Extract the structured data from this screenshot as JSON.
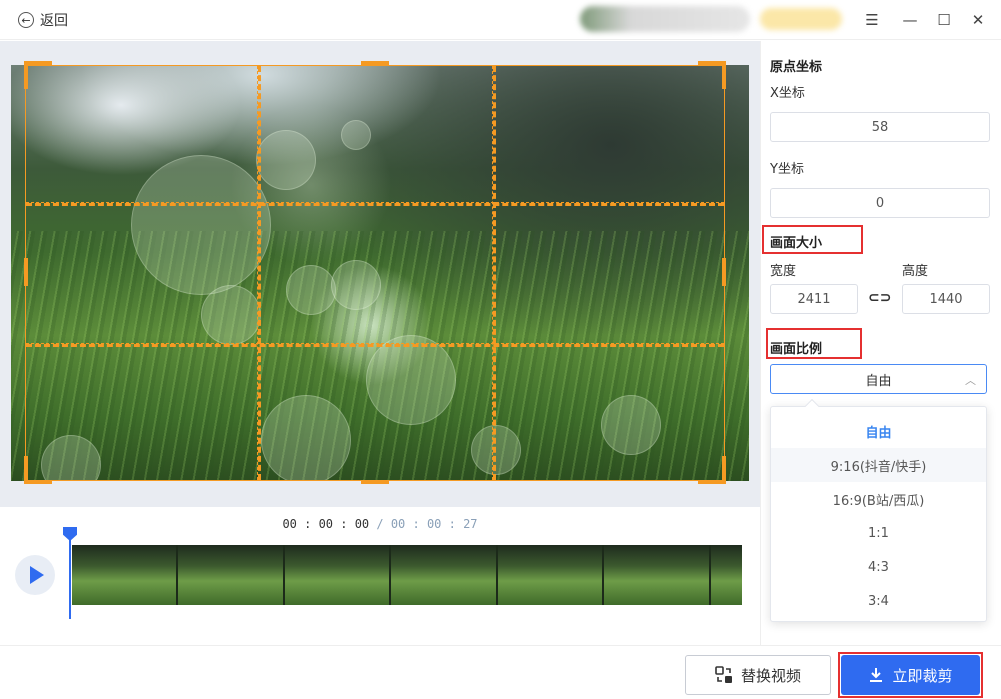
{
  "titlebar": {
    "back_label": "返回",
    "icons": [
      "back-arrow-icon",
      "menu-icon",
      "minimize-icon",
      "maximize-icon",
      "close-icon"
    ]
  },
  "timeline": {
    "current_time": "00 : 00 : 00",
    "total_time": " / 00 : 00 : 27"
  },
  "side": {
    "origin_title": "原点坐标",
    "x_label": "X坐标",
    "x_value": "58",
    "y_label": "Y坐标",
    "y_value": "0",
    "size_title": "画面大小",
    "width_label": "宽度",
    "width_value": "2411",
    "height_label": "高度",
    "height_value": "1440",
    "ratio_title": "画面比例",
    "ratio_selected": "自由",
    "ratio_options": [
      "自由",
      "9:16(抖音/快手)",
      "16:9(B站/西瓜)",
      "1:1",
      "4:3",
      "3:4"
    ]
  },
  "footer": {
    "replace_label": "替换视频",
    "crop_label": "立即裁剪"
  },
  "colors": {
    "accent": "#2f6bf0",
    "crop_frame": "#f59a23",
    "highlight_box": "#e53030"
  }
}
